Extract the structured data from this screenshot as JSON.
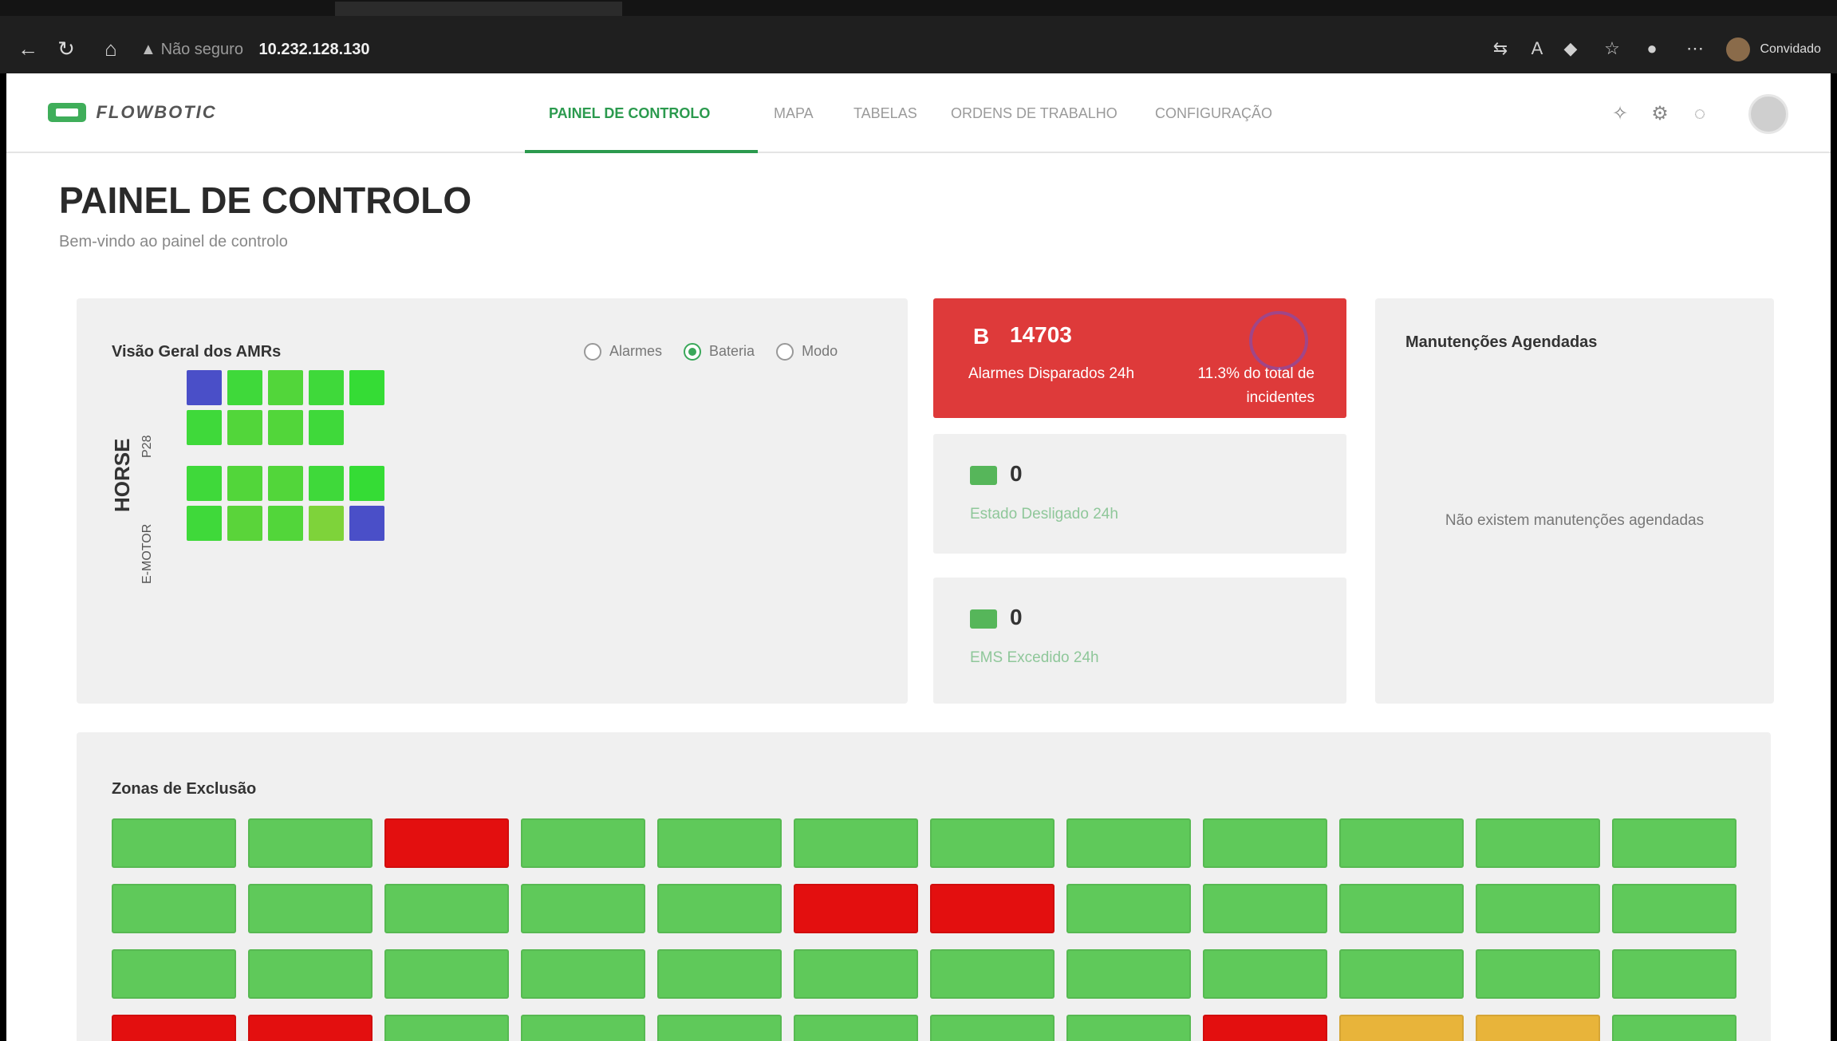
{
  "browser": {
    "tabs": [],
    "omnibox": {
      "security_label": "Não seguro",
      "url": "10.232.128.130"
    },
    "profile_label": "Convidado"
  },
  "app": {
    "logo_text": "FLOWBOTIC",
    "nav_tabs": [
      {
        "label": "PAINEL DE CONTROLO",
        "active": true
      },
      {
        "label": "MAPA",
        "active": false
      },
      {
        "label": "TABELAS",
        "active": false
      },
      {
        "label": "ORDENS DE TRABALHO",
        "active": false
      },
      {
        "label": "CONFIGURAÇÃO",
        "active": false
      }
    ],
    "page_title": "PAINEL DE CONTROLO",
    "page_subtitle": "Bem-vindo ao painel de controlo"
  },
  "amr_overview": {
    "title": "Visão Geral dos AMRs",
    "radio_options": [
      {
        "label": "Alarmes",
        "checked": false
      },
      {
        "label": "Bateria",
        "checked": true
      },
      {
        "label": "Modo",
        "checked": false
      }
    ],
    "group_label": "HORSE",
    "sub_groups": [
      {
        "label": "P28",
        "rows": [
          [
            "#4a4fc8",
            "#3fd93a",
            "#52d63a",
            "#3fd93a",
            "#35dc35"
          ],
          [
            "#3fd93a",
            "#52d63a",
            "#52d63a",
            "#3fd93a"
          ]
        ]
      },
      {
        "label": "E-MOTOR",
        "rows": [
          [
            "#3fd93a",
            "#52d63a",
            "#52d63a",
            "#3fd93a",
            "#35dc35"
          ],
          [
            "#3fd93a",
            "#5ad43a",
            "#52d63a",
            "#7ed33a",
            "#4a4fc8"
          ]
        ]
      }
    ]
  },
  "alarm_card": {
    "icon": "B",
    "count": "14703",
    "label": "Alarmes Disparados 24h",
    "percent_text": "11.3% do total de incidentes",
    "color": "#de3a3a"
  },
  "stat_cards": [
    {
      "count": "0",
      "label": "Estado Desligado 24h",
      "icon": "status-icon"
    },
    {
      "count": "0",
      "label": "EMS Excedido 24h",
      "icon": "ems-icon"
    }
  ],
  "maintenance": {
    "title": "Manutenções Agendadas",
    "empty_text": "Não existem manutenções agendadas"
  },
  "exclusion_zones": {
    "title": "Zonas de Exclusão",
    "zones": [
      [
        "green",
        "green",
        "red",
        "green",
        "green",
        "green",
        "green",
        "green",
        "green",
        "green",
        "green",
        "green"
      ],
      [
        "green",
        "green",
        "green",
        "green",
        "green",
        "red",
        "red",
        "green",
        "green",
        "green",
        "green",
        "green"
      ],
      [
        "green",
        "green",
        "green",
        "green",
        "green",
        "green",
        "green",
        "green",
        "green",
        "green",
        "green",
        "green"
      ],
      [
        "red",
        "red",
        "green",
        "green",
        "green",
        "green",
        "green",
        "green",
        "red",
        "orange",
        "orange",
        "green"
      ]
    ],
    "colors": {
      "green": "#5fc95a",
      "red": "#e30f0f",
      "orange": "#e8b43a"
    }
  }
}
